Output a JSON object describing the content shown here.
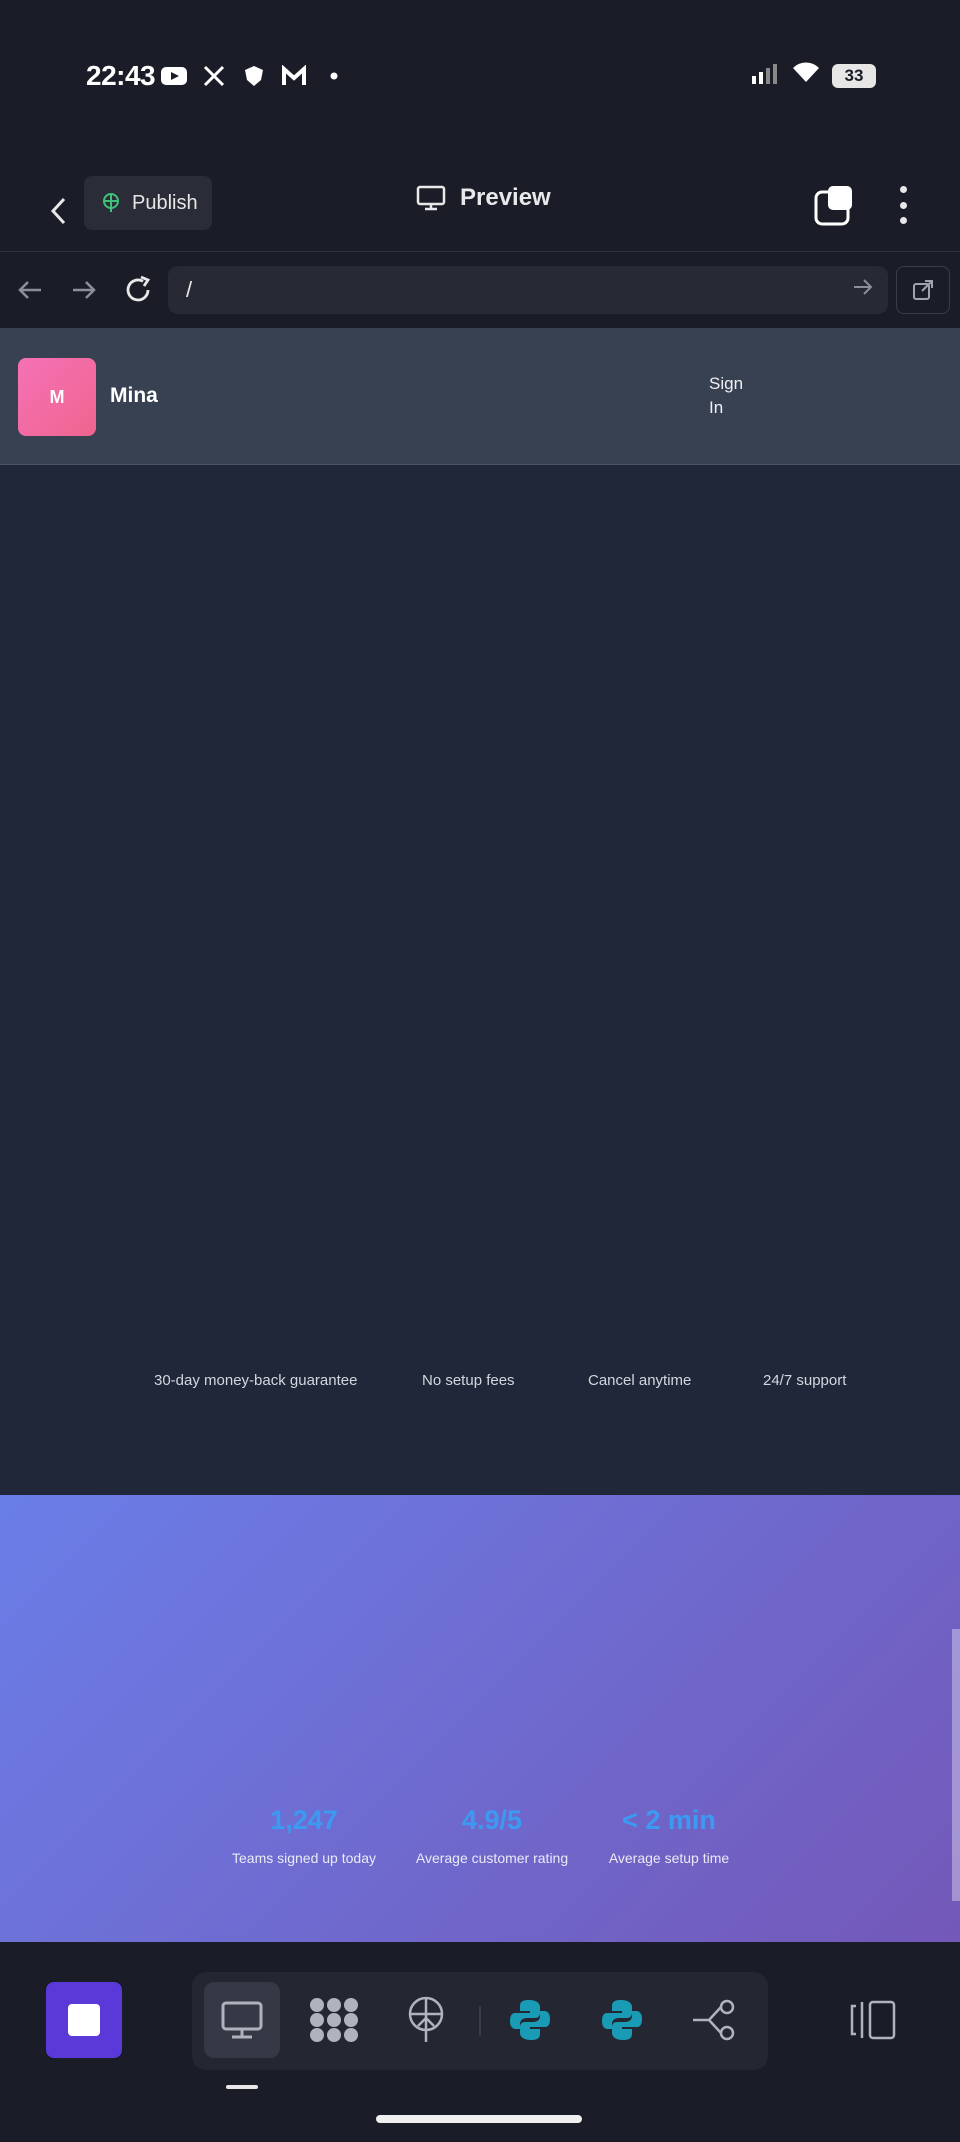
{
  "status_bar": {
    "time": "22:43",
    "battery": "33",
    "apps": [
      "youtube-icon",
      "x-icon",
      "shield-app-icon",
      "m-app-icon",
      "dot"
    ]
  },
  "header": {
    "publish_label": "Publish",
    "preview_label": "Preview"
  },
  "address_bar": {
    "url": "/"
  },
  "site": {
    "logo_letter": "M",
    "brand_name": "Mina",
    "signin_label": "Sign In",
    "guarantees": [
      "30-day money-back guarantee",
      "No setup fees",
      "Cancel anytime",
      "24/7 support"
    ],
    "stats": [
      {
        "value": "1,247",
        "label": "Teams signed up today"
      },
      {
        "value": "4.9/5",
        "label": "Average customer rating"
      },
      {
        "value": "< 2 min",
        "label": "Average setup time"
      }
    ]
  },
  "colors": {
    "background": "#1a1d27",
    "accent_purple": "#5b38d8",
    "stat_blue": "#3b9bf2",
    "logo_pink": "#f472b6",
    "python_teal": "#1a9bb5"
  },
  "toolbar": {
    "tools": [
      "desktop-icon",
      "apps-grid-icon",
      "deploy-icon",
      "python-icon",
      "python-icon",
      "flow-icon"
    ]
  }
}
